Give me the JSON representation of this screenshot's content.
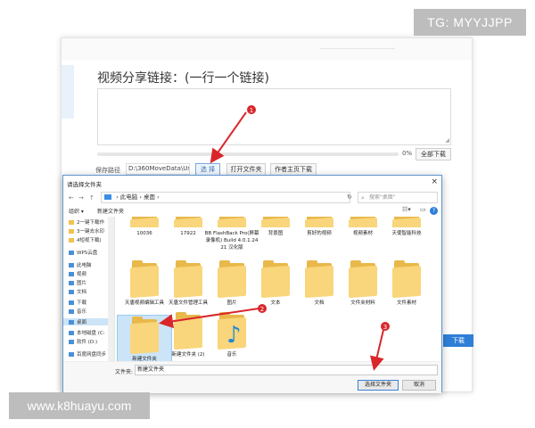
{
  "watermarks": {
    "tg": "TG: MYYJJPP",
    "site": "www.k8huayu.com"
  },
  "app": {
    "title_small": "——————————————",
    "heading": "视频分享链接：(一行一个链接)",
    "progress_percent": 0,
    "progress_label": "0%",
    "download_all": "全部下载",
    "save_label": "保存路径",
    "save_path": "D:\\360MoveData\\Users\\",
    "select_button": "选 择",
    "open_folder": "打开文件夹",
    "author_download": "作者主页下载",
    "right_button": "下载"
  },
  "dialog": {
    "title": "请选择文件夹",
    "close": "×",
    "breadcrumb": [
      "此电脑",
      "桌面"
    ],
    "search_placeholder": "搜索\"桌面\"",
    "toolbar": {
      "organize": "组织 ▾",
      "new_folder": "新建文件夹"
    },
    "sidebar": [
      {
        "label": "2一键下载作",
        "icon": "folder-icon"
      },
      {
        "label": "3一键去水印",
        "icon": "folder-icon"
      },
      {
        "label": "4短视下载(",
        "icon": "folder-icon"
      },
      {
        "label": "WPS云盘",
        "icon": "cloud-icon"
      },
      {
        "label": "此电脑",
        "icon": "computer-icon"
      },
      {
        "label": "视频",
        "icon": "video-icon"
      },
      {
        "label": "图片",
        "icon": "picture-icon"
      },
      {
        "label": "文档",
        "icon": "document-icon"
      },
      {
        "label": "下载",
        "icon": "download-icon"
      },
      {
        "label": "音乐",
        "icon": "music-icon"
      },
      {
        "label": "桌面",
        "icon": "desktop-icon"
      },
      {
        "label": "本地磁盘 (C:",
        "icon": "drive-icon"
      },
      {
        "label": "软件 (D:)",
        "icon": "drive-icon"
      },
      {
        "label": "百度网盘同步",
        "icon": "cloud-icon"
      }
    ],
    "row1": [
      {
        "label": "10036"
      },
      {
        "label": "17922"
      },
      {
        "label": "BB FlashBack Pro(屏幕录像机) Build 4.0.1.2421 汉化版"
      },
      {
        "label": "背景图"
      },
      {
        "label": "剪好的视频"
      },
      {
        "label": "视频素材"
      },
      {
        "label": "天使智能科技"
      }
    ],
    "row2": [
      {
        "label": "天唐视频编辑工具"
      },
      {
        "label": "天唐文件管理工具"
      },
      {
        "label": "图片"
      },
      {
        "label": "文本"
      },
      {
        "label": "文档"
      },
      {
        "label": "文件夹材料"
      },
      {
        "label": "文件素材"
      }
    ],
    "row3": [
      {
        "label": "新建文件夹",
        "selected": true
      },
      {
        "label": "新建文件夹 (2)"
      },
      {
        "label": "音乐",
        "music": true
      }
    ],
    "folder_label": "文件夹:",
    "folder_value": "新建文件夹",
    "select_folder_button": "选择文件夹",
    "cancel_button": "取消"
  },
  "annotations": [
    "1",
    "2",
    "3"
  ],
  "colors": {
    "accent": "#2f7fd8",
    "annotation": "#d9262a",
    "folder": "#f9d57b"
  }
}
